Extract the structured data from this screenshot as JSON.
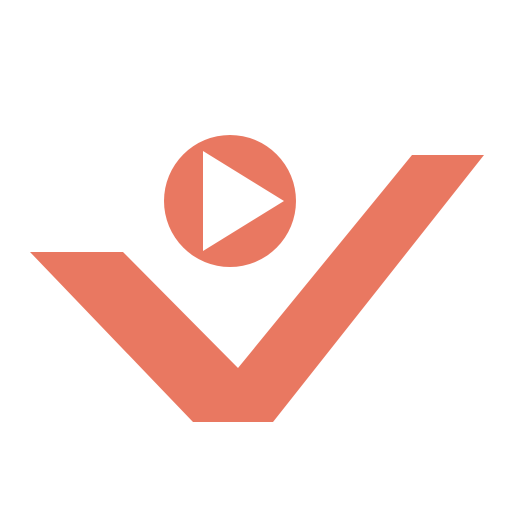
{
  "logo": {
    "name": "play-checkmark-logo",
    "icon": "play-check-icon",
    "colors": {
      "accent": "#E97861",
      "background": "#FFFFFF",
      "play_triangle": "#FFFFFF"
    }
  }
}
